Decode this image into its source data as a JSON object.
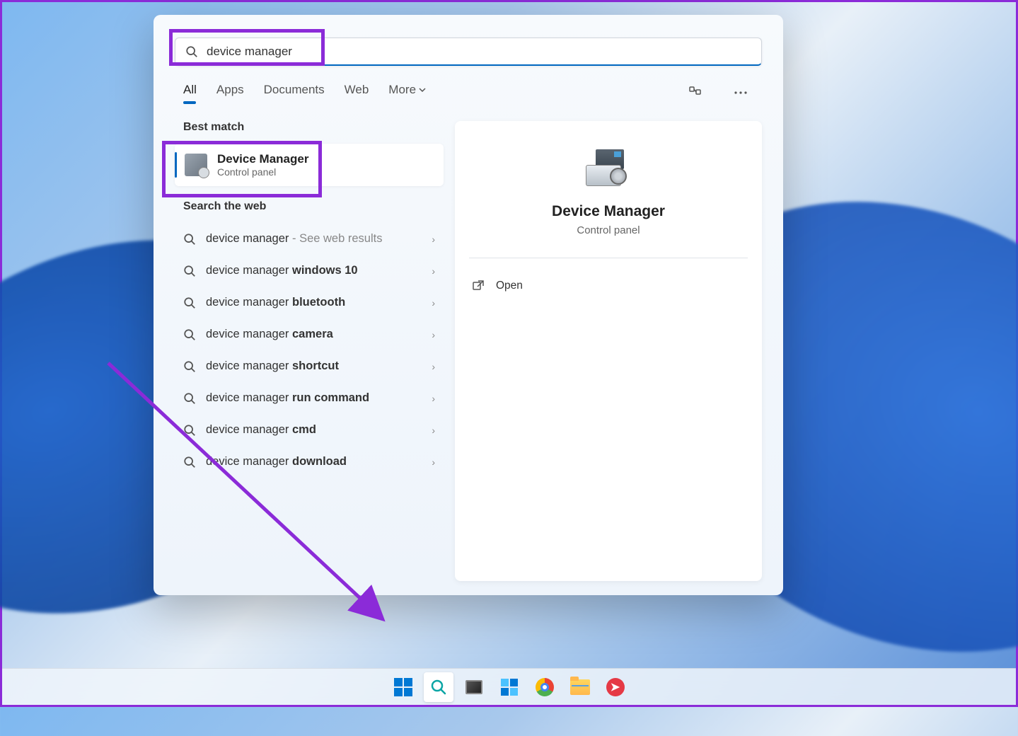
{
  "search": {
    "query": "device manager"
  },
  "tabs": {
    "all": "All",
    "apps": "Apps",
    "documents": "Documents",
    "web": "Web",
    "more": "More"
  },
  "sections": {
    "best_match": "Best match",
    "search_web": "Search the web"
  },
  "best_match": {
    "title": "Device Manager",
    "subtitle": "Control panel"
  },
  "web_results": [
    {
      "prefix": "device manager",
      "bold": "",
      "suffix": " - See web results"
    },
    {
      "prefix": "device manager ",
      "bold": "windows 10",
      "suffix": ""
    },
    {
      "prefix": "device manager ",
      "bold": "bluetooth",
      "suffix": ""
    },
    {
      "prefix": "device manager ",
      "bold": "camera",
      "suffix": ""
    },
    {
      "prefix": "device manager ",
      "bold": "shortcut",
      "suffix": ""
    },
    {
      "prefix": "device manager ",
      "bold": "run command",
      "suffix": ""
    },
    {
      "prefix": "device manager ",
      "bold": "cmd",
      "suffix": ""
    },
    {
      "prefix": "device manager ",
      "bold": "download",
      "suffix": ""
    }
  ],
  "preview": {
    "title": "Device Manager",
    "subtitle": "Control panel",
    "actions": {
      "open": "Open"
    }
  }
}
